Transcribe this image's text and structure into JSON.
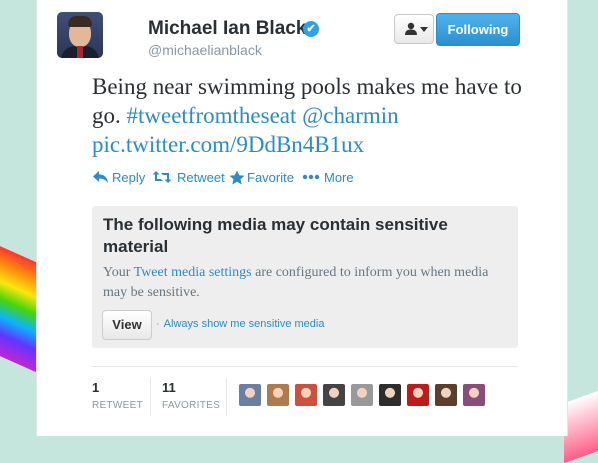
{
  "user": {
    "name": "Michael Ian Black",
    "handle": "@michaelianblack",
    "verified_glyph": "✔"
  },
  "follow_button": {
    "label": "Following"
  },
  "user_menu": {
    "icon": "person-icon"
  },
  "tweet": {
    "text_plain": "Being near swimming pools makes me have to go. ",
    "hashtag": "#tweetfromtheseat",
    "mention": "@charmin",
    "link": "pic.twitter.com/9DdBn4B1ux"
  },
  "actions": {
    "reply": "Reply",
    "retweet": "Retweet",
    "favorite": "Favorite",
    "more": "More"
  },
  "sensitive": {
    "title": "The following media may contain sensitive material",
    "desc_pre": "Your ",
    "desc_link": "Tweet media settings",
    "desc_post": " are configured to inform you when media may be sensitive.",
    "view_label": "View",
    "always_show": "Always show me sensitive media"
  },
  "stats": {
    "retweets": {
      "count": "1",
      "label": "RETWEET"
    },
    "favorites": {
      "count": "11",
      "label": "FAVORITES"
    }
  },
  "colors": {
    "link": "#2a8cc8",
    "follow_blue": "#2b8fd1",
    "background": "#c5e6dc"
  },
  "favoriter_avatars": [
    "#6b7fa3",
    "#b07a4d",
    "#d04e3c",
    "#444444",
    "#999999",
    "#2d2d2d",
    "#c01a1a",
    "#5a3f2e",
    "#8a4d7a"
  ]
}
